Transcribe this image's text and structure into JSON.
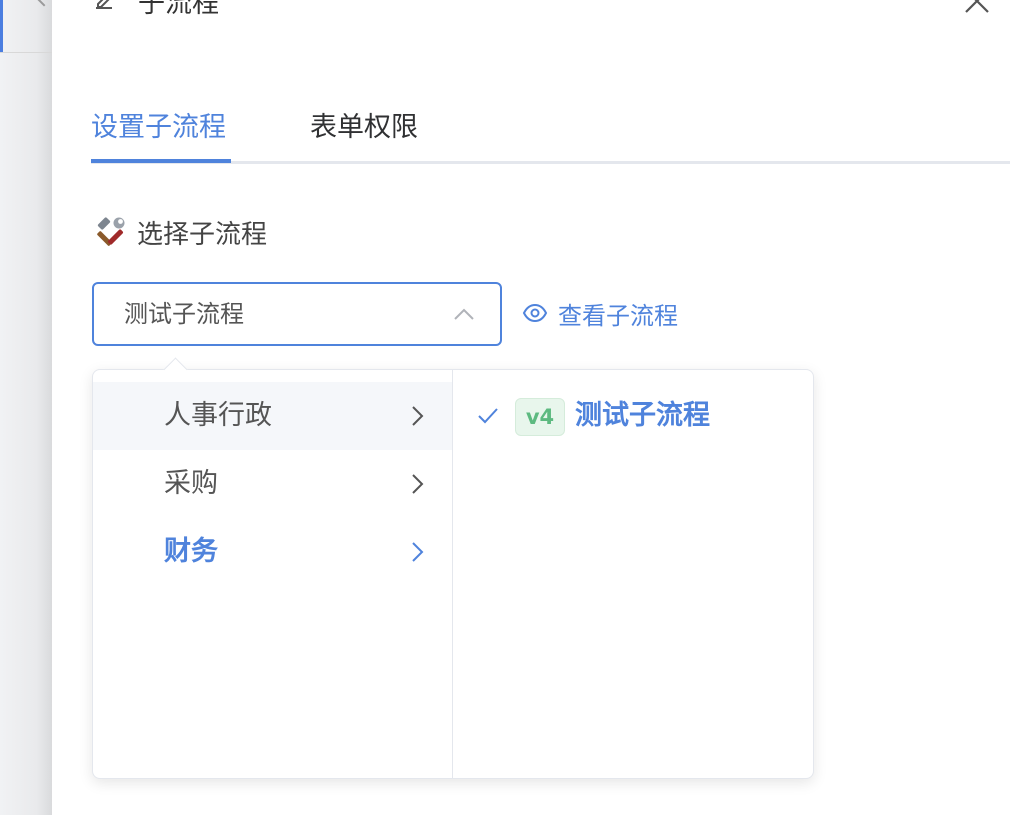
{
  "header": {
    "title": "子流程",
    "edit_icon": "edit-icon",
    "close_icon": "close-icon"
  },
  "tabs": [
    {
      "label": "设置子流程",
      "active": true
    },
    {
      "label": "表单权限",
      "active": false
    }
  ],
  "section": {
    "icon": "tools-icon",
    "label": "选择子流程"
  },
  "select": {
    "value": "测试子流程",
    "expanded": true
  },
  "view_link": {
    "icon": "eye-icon",
    "label": "查看子流程"
  },
  "cascader": {
    "categories": [
      {
        "label": "人事行政",
        "state": "hover"
      },
      {
        "label": "采购",
        "state": "normal"
      },
      {
        "label": "财务",
        "state": "selected"
      }
    ],
    "options": [
      {
        "version": "v4",
        "label": "测试子流程",
        "checked": true
      }
    ]
  },
  "colors": {
    "accent": "#4f83dc",
    "badge_bg": "#e8f6ec",
    "badge_text": "#5dba80"
  }
}
